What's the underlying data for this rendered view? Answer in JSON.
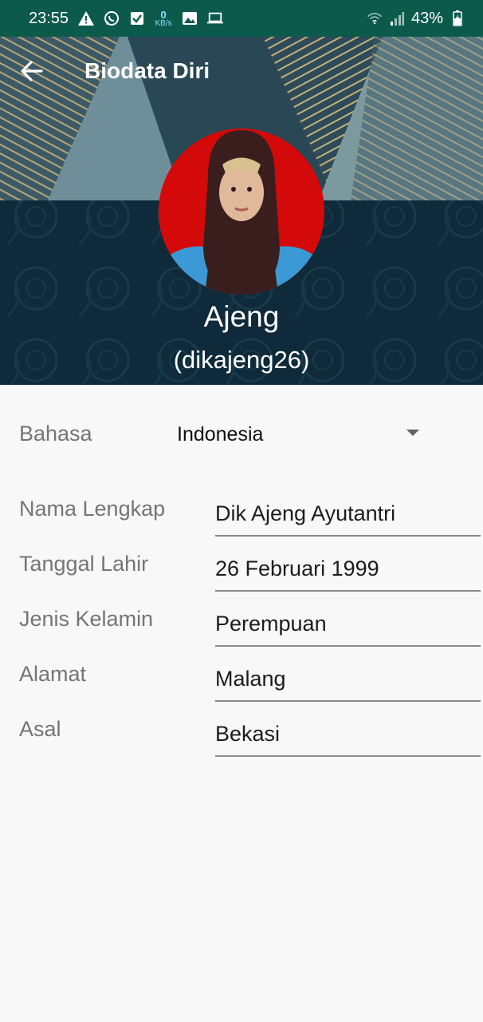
{
  "status_bar": {
    "time": "23:55",
    "speed_value": "0",
    "speed_unit": "KB/s",
    "battery": "43%",
    "icons": [
      "warning-icon",
      "whatsapp-icon",
      "check-box-icon",
      "image-icon",
      "laptop-icon",
      "wifi-icon",
      "signal-icon",
      "battery-charging-icon"
    ]
  },
  "app_bar": {
    "title": "Biodata Diri",
    "back_icon": "arrow-left-icon"
  },
  "profile": {
    "name": "Ajeng",
    "username": "(dikajeng26)"
  },
  "language": {
    "label": "Bahasa",
    "selected": "Indonesia"
  },
  "fields": [
    {
      "label": "Nama Lengkap",
      "value": "Dik Ajeng Ayutantri"
    },
    {
      "label": "Tanggal Lahir",
      "value": "26 Februari 1999"
    },
    {
      "label": "Jenis Kelamin",
      "value": "Perempuan"
    },
    {
      "label": "Alamat",
      "value": "Malang"
    },
    {
      "label": "Asal",
      "value": "Bekasi"
    }
  ],
  "colors": {
    "status_bar": "#0c5a4c",
    "header_dark": "#10283a",
    "avatar_background": "#d40a0a",
    "label_text": "#757575"
  }
}
